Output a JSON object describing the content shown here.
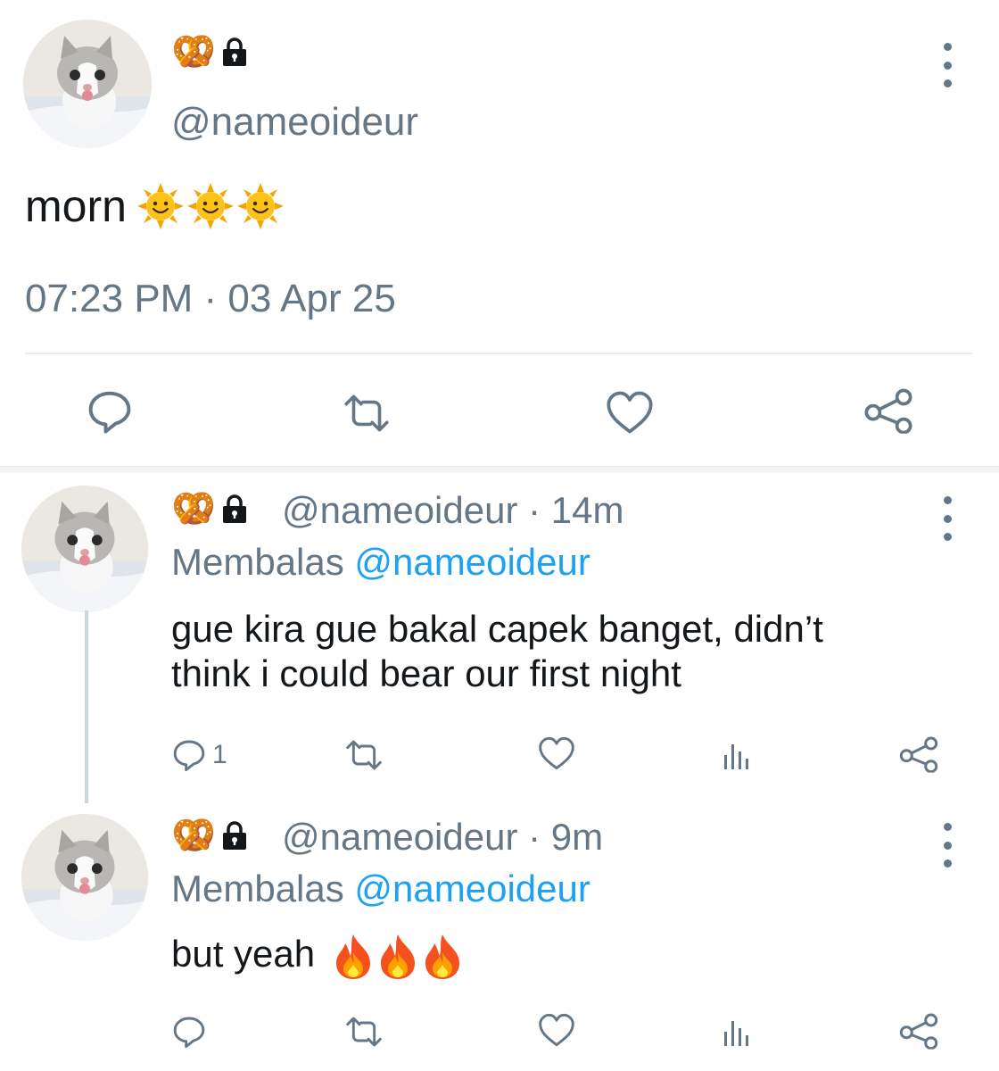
{
  "main_tweet": {
    "badge_pretzel": "🥨",
    "handle": "@nameoideur",
    "text": "morn",
    "emojis": [
      "sun-face",
      "sun-face",
      "sun-face"
    ],
    "timestamp": "07:23 PM · 03 Apr 25",
    "actions": [
      "reply-icon",
      "retweet-icon",
      "like-icon",
      "share-icon"
    ]
  },
  "replies": [
    {
      "badge_pretzel": "🥨",
      "handle_time": "@nameoideur · 14m",
      "replying_prefix": "Membalas",
      "replying_mention": "@nameoideur",
      "text_line1": "gue kira gue bakal capek banget, didn’t",
      "text_line2": "think i could bear our first night",
      "reply_count": "1",
      "actions": [
        "reply-icon",
        "retweet-icon",
        "like-icon",
        "analytics-icon",
        "share-icon"
      ]
    },
    {
      "badge_pretzel": "🥨",
      "handle_time": "@nameoideur · 9m",
      "replying_prefix": "Membalas",
      "replying_mention": "@nameoideur",
      "text_line1": "but yeah",
      "emojis": [
        "fire",
        "fire",
        "fire"
      ],
      "actions": [
        "reply-icon",
        "retweet-icon",
        "like-icon",
        "analytics-icon",
        "share-icon"
      ]
    }
  ],
  "colors": {
    "text": "#14171a",
    "muted": "#657786",
    "link": "#1da1f2",
    "divider": "#e6ecf0"
  }
}
